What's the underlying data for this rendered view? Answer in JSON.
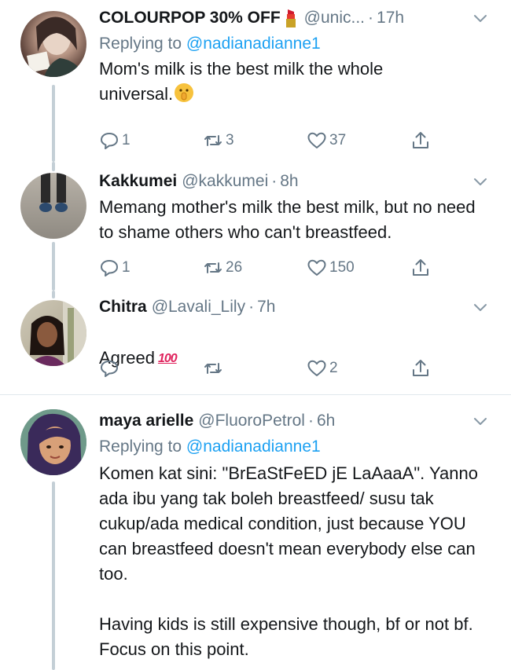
{
  "tweets": [
    {
      "name": "COLOURPOP 30% OFF",
      "handle": "@unic...",
      "time": "17h",
      "replying_prefix": "Replying to",
      "replying_to": "@nadianadianne1",
      "text": "Mom's milk is the best milk the whole universal.",
      "replies": "1",
      "retweets": "3",
      "likes": "37",
      "name_emoji": "lipstick-icon",
      "text_emoji": "shushing-face-icon"
    },
    {
      "name": "Kakkumei",
      "handle": "@kakkumei",
      "time": "8h",
      "text": "Memang mother's milk the best milk, but no need to shame others who can't breastfeed.",
      "replies": "1",
      "retweets": "26",
      "likes": "150"
    },
    {
      "name": "Chitra",
      "handle": "@Lavali_Lily",
      "time": "7h",
      "text": "Agreed",
      "text_emoji_label": "100",
      "replies": "",
      "retweets": "",
      "likes": "2"
    },
    {
      "name": "maya arielle",
      "handle": "@FluoroPetrol",
      "time": "6h",
      "replying_prefix": "Replying to",
      "replying_to": "@nadianadianne1",
      "text": "Komen kat sini: \"BrEaStFeED jE LaAaaA\". Yanno ada ibu yang tak boleh breastfeed/ susu tak cukup/ada medical condition, just because YOU can breastfeed doesn't mean everybody else can too.\n\nHaving kids is still expensive though, bf or not bf. Focus on this point."
    }
  ],
  "colors": {
    "link": "#1da1f2",
    "secondary": "#657786",
    "thread_line": "#c4cfd6",
    "emoji_100": "#e0245e"
  }
}
